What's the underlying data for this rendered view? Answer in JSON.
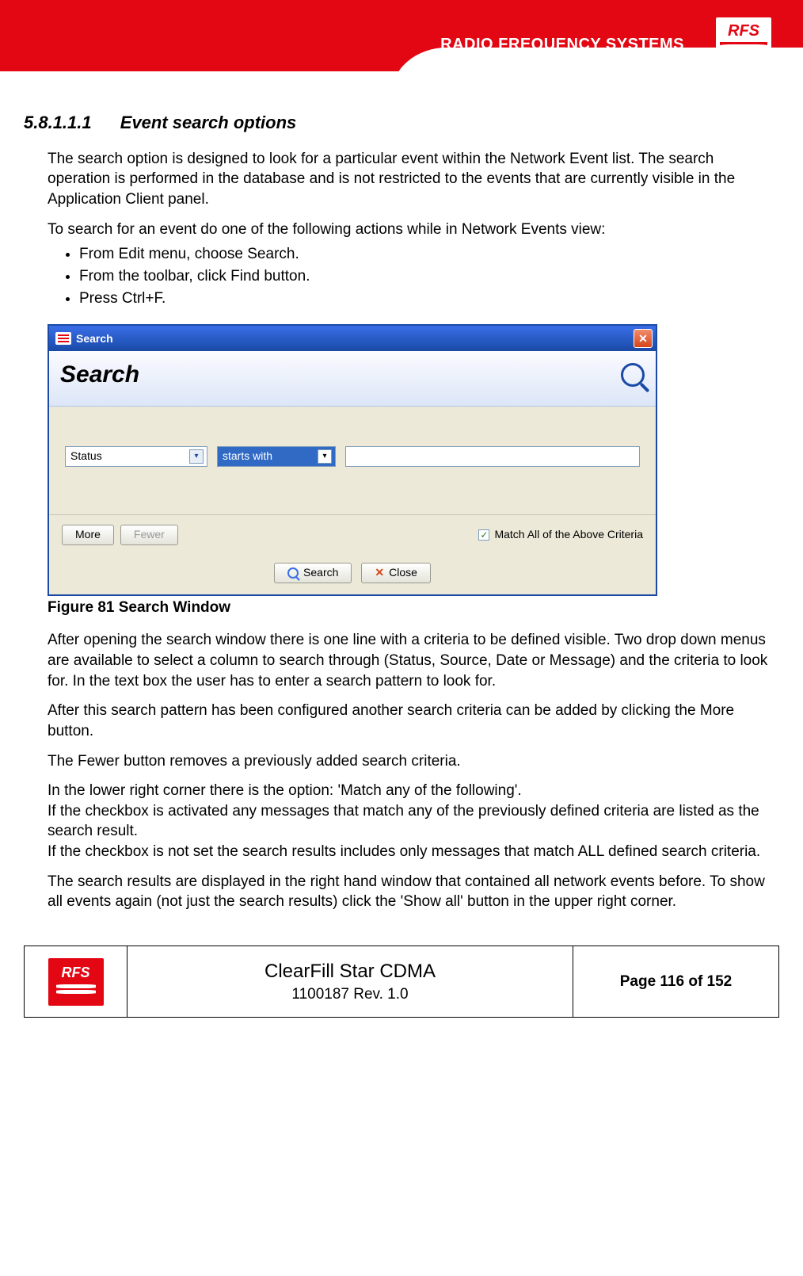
{
  "header": {
    "brand_text": "RADIO FREQUENCY SYSTEMS",
    "logo_text": "RFS"
  },
  "section": {
    "number": "5.8.1.1.1",
    "title": "Event search options"
  },
  "paragraphs": {
    "p1": "The search option is designed to look for a particular event within the Network Event list. The search operation is performed in the database and is not restricted to the events that are currently visible in the Application Client panel.",
    "p2": "To search for an event do one of the following actions while in Network Events view:",
    "p3": "After opening the search window there is one line with a criteria to be defined visible. Two drop down menus are available to select a column to search through (Status, Source, Date or Message) and the criteria to look for. In the text box the user has to enter a search pattern to look for.",
    "p4": "After this search pattern has been configured another search criteria can be added by clicking the More button.",
    "p5": "The Fewer button removes a previously added search criteria.",
    "p6a": "In the lower right corner there is the option: 'Match any of the following'.",
    "p6b": "If the checkbox is activated any messages that match any of the previously defined criteria are listed as the search result.",
    "p6c": "If the checkbox is not set the search results includes only messages that match ALL defined search criteria.",
    "p7": "The search results are displayed in the right hand window that contained all network events before. To show all events again (not just the search results) click the 'Show all' button in the upper right corner."
  },
  "bullets": [
    "From Edit menu, choose Search.",
    "From the toolbar, click Find button.",
    "Press Ctrl+F."
  ],
  "figure_caption": "Figure 81 Search Window",
  "search_window": {
    "title_bar": "Search",
    "heading": "Search",
    "field_dropdown": "Status",
    "condition_dropdown": "starts with",
    "text_value": "",
    "more_btn": "More",
    "fewer_btn": "Fewer",
    "match_label": "Match All of the Above Criteria",
    "match_checked": true,
    "search_btn": "Search",
    "close_btn": "Close"
  },
  "footer": {
    "title": "ClearFill Star CDMA",
    "doc_rev": "1100187 Rev. 1.0",
    "page": "Page 116 of 152",
    "logo_text": "RFS"
  }
}
